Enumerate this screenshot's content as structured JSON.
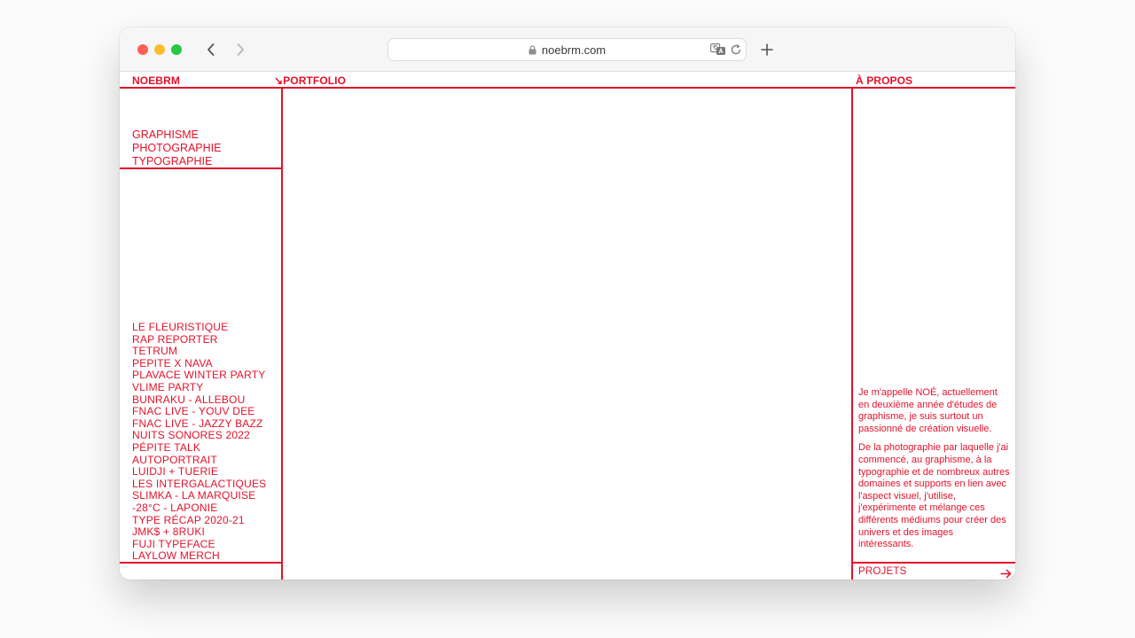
{
  "browser": {
    "url": "noebrm.com"
  },
  "header": {
    "brand": "NOEBRM",
    "portfolio": "↘PORTFOLIO",
    "about": "À PROPOS"
  },
  "categories": [
    "GRAPHISME",
    "PHOTOGRAPHIE",
    "TYPOGRAPHIE"
  ],
  "projects": [
    "LE FLEURISTIQUE",
    "RAP REPORTER",
    "TETRUM",
    "PEPITE X NAVA",
    "PLAVACE WINTER PARTY",
    "VLIME PARTY",
    "BUNRAKU - ALLEBOU",
    "FNAC LIVE - YOUV DEE",
    "FNAC LIVE - JAZZY BAZZ",
    "NUITS SONORES 2022",
    "PÉPITE TALK",
    "AUTOPORTRAIT",
    "LUIDJI + TUERIE",
    "LES INTERGALACTIQUES",
    "SLIMKA - LA MARQUISE",
    "-28°C - LAPONIE",
    "TYPE RÉCAP 2020-21",
    "JMK$ + 8RUKI",
    "FUJI TYPEFACE",
    "LAYLOW MERCH"
  ],
  "about": {
    "paragraph1": "Je m'appelle NOÉ, actuellement en deuxième année d'études de graphisme, je suis surtout un passionné de création visuelle.",
    "paragraph2": "De la photographie par laquelle j'ai commencé, au graphisme, à la typographie et de nombreux autres domaines et supports en lien avec l'aspect visuel, j'utilise, j'expérimente et mélange ces différents médiums pour créer des univers et des images intéressants."
  },
  "footer": {
    "projets_label": "PROJETS"
  },
  "colors": {
    "accent": "#e3122b"
  }
}
